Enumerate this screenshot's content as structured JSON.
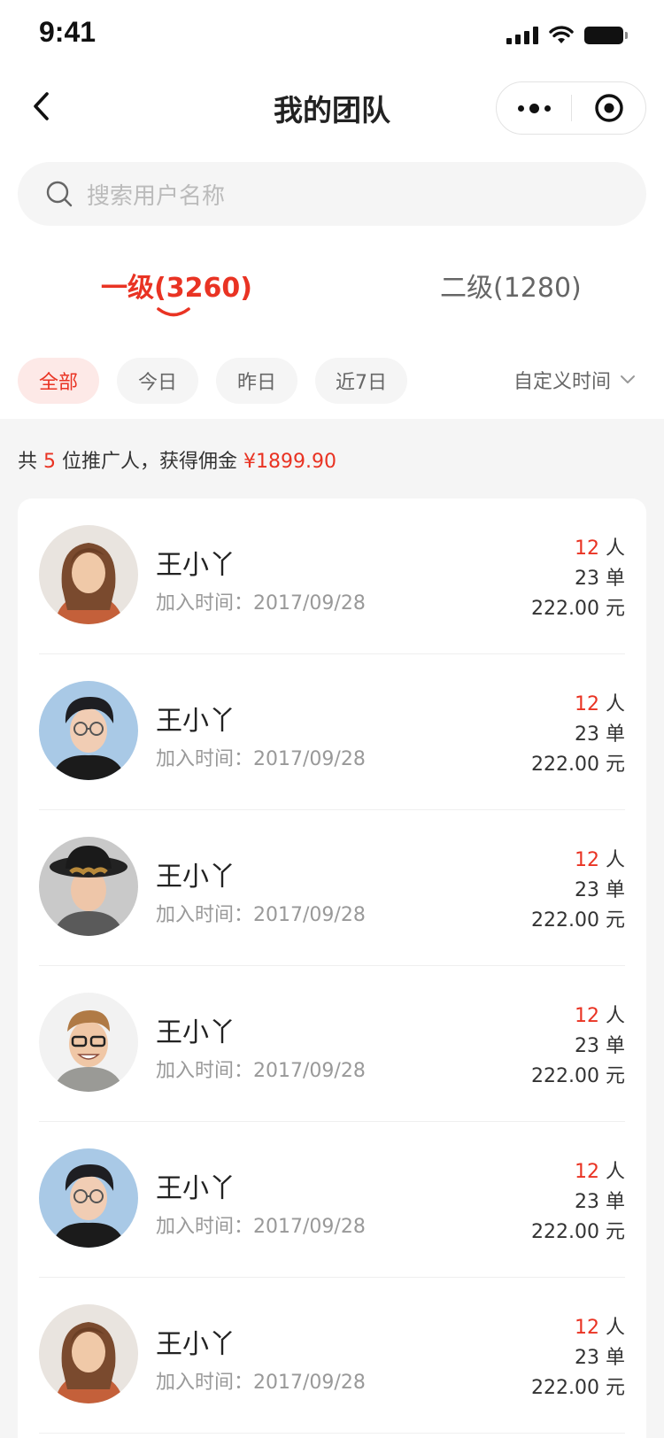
{
  "status_bar": {
    "time": "9:41"
  },
  "header": {
    "title": "我的团队"
  },
  "search": {
    "placeholder": "搜索用户名称"
  },
  "tabs": [
    {
      "label": "一级(3260)",
      "active": true
    },
    {
      "label": "二级(1280)",
      "active": false
    }
  ],
  "filters": [
    {
      "label": "全部",
      "active": true
    },
    {
      "label": "今日",
      "active": false
    },
    {
      "label": "昨日",
      "active": false
    },
    {
      "label": "近7日",
      "active": false
    }
  ],
  "custom_time": {
    "label": "自定义时间"
  },
  "summary": {
    "prefix": "共",
    "count": "5",
    "middle": "位推广人，获得佣金",
    "amount": "¥1899.90"
  },
  "members": [
    {
      "name": "王小丫",
      "join_label": "加入时间：",
      "join_date": "2017/09/28",
      "people": "12",
      "people_unit": "人",
      "orders": "23 单",
      "amount": "222.00 元",
      "avatar": "avatar-woman-long-hair"
    },
    {
      "name": "王小丫",
      "join_label": "加入时间：",
      "join_date": "2017/09/28",
      "people": "12",
      "people_unit": "人",
      "orders": "23 单",
      "amount": "222.00 元",
      "avatar": "avatar-man-glasses-scarf"
    },
    {
      "name": "王小丫",
      "join_label": "加入时间：",
      "join_date": "2017/09/28",
      "people": "12",
      "people_unit": "人",
      "orders": "23 单",
      "amount": "222.00 元",
      "avatar": "avatar-man-hat"
    },
    {
      "name": "王小丫",
      "join_label": "加入时间：",
      "join_date": "2017/09/28",
      "people": "12",
      "people_unit": "人",
      "orders": "23 单",
      "amount": "222.00 元",
      "avatar": "avatar-man-smiling-glasses"
    },
    {
      "name": "王小丫",
      "join_label": "加入时间：",
      "join_date": "2017/09/28",
      "people": "12",
      "people_unit": "人",
      "orders": "23 单",
      "amount": "222.00 元",
      "avatar": "avatar-man-glasses-scarf"
    },
    {
      "name": "王小丫",
      "join_label": "加入时间：",
      "join_date": "2017/09/28",
      "people": "12",
      "people_unit": "人",
      "orders": "23 单",
      "amount": "222.00 元",
      "avatar": "avatar-woman-long-hair"
    }
  ],
  "colors": {
    "accent": "#e93323",
    "page_bg": "#f5f5f5",
    "chip_active_bg": "#fde9e7"
  }
}
